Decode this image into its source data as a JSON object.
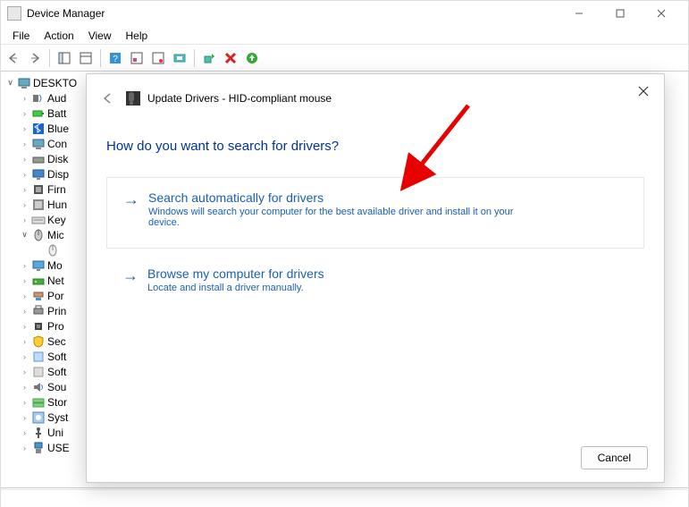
{
  "titlebar": {
    "title": "Device Manager"
  },
  "menubar": {
    "file": "File",
    "action": "Action",
    "view": "View",
    "help": "Help"
  },
  "tree": {
    "root": "DESKTO",
    "items": [
      {
        "label": "Aud",
        "icon": "audio"
      },
      {
        "label": "Batt",
        "icon": "battery"
      },
      {
        "label": "Blue",
        "icon": "bluetooth"
      },
      {
        "label": "Con",
        "icon": "computer"
      },
      {
        "label": "Disk",
        "icon": "disk"
      },
      {
        "label": "Disp",
        "icon": "display"
      },
      {
        "label": "Firn",
        "icon": "firmware"
      },
      {
        "label": "Hun",
        "icon": "hid"
      },
      {
        "label": "Key",
        "icon": "keyboard"
      },
      {
        "label": "Mic",
        "icon": "mouse",
        "open": true,
        "child": {
          "label": "",
          "icon": "mouse-dev"
        }
      },
      {
        "label": "Mo",
        "icon": "monitor"
      },
      {
        "label": "Net",
        "icon": "network"
      },
      {
        "label": "Por",
        "icon": "port"
      },
      {
        "label": "Prin",
        "icon": "printer"
      },
      {
        "label": "Pro",
        "icon": "cpu"
      },
      {
        "label": "Sec",
        "icon": "security"
      },
      {
        "label": "Soft",
        "icon": "soft1"
      },
      {
        "label": "Soft",
        "icon": "soft2"
      },
      {
        "label": "Sou",
        "icon": "sound"
      },
      {
        "label": "Stor",
        "icon": "storage"
      },
      {
        "label": "Syst",
        "icon": "system"
      },
      {
        "label": "Uni",
        "icon": "usb"
      },
      {
        "label": "USE",
        "icon": "usb2"
      }
    ]
  },
  "dialog": {
    "title_prefix": "Update Drivers - ",
    "title_device": "HID-compliant mouse",
    "heading": "How do you want to search for drivers?",
    "option1": {
      "title": "Search automatically for drivers",
      "desc": "Windows will search your computer for the best available driver and install it on your device."
    },
    "option2": {
      "title": "Browse my computer for drivers",
      "desc": "Locate and install a driver manually."
    },
    "cancel": "Cancel"
  }
}
